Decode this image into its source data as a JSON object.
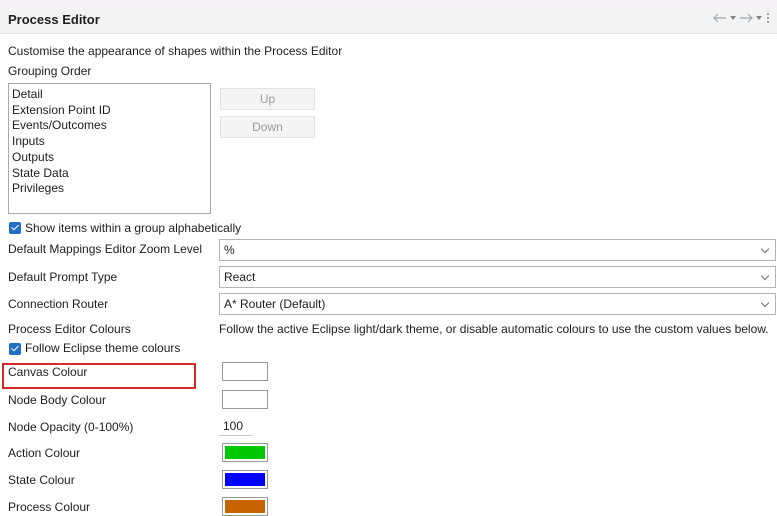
{
  "header": {
    "title": "Process Editor"
  },
  "description": "Customise the appearance of shapes within the Process Editor",
  "grouping": {
    "label": "Grouping Order",
    "items": [
      "Detail",
      "Extension Point ID",
      "Events/Outcomes",
      "Inputs",
      "Outputs",
      "State Data",
      "Privileges"
    ],
    "up_label": "Up",
    "down_label": "Down"
  },
  "show_alpha": {
    "label": "Show items within a group alphabetically",
    "checked": true
  },
  "zoom": {
    "label": "Default Mappings Editor Zoom Level",
    "value": "%"
  },
  "prompt": {
    "label": "Default Prompt Type",
    "value": "React"
  },
  "router": {
    "label": "Connection Router",
    "value": "A* Router (Default)"
  },
  "colours": {
    "label": "Process Editor Colours",
    "hint": "Follow the active Eclipse light/dark theme, or disable automatic colours to use the custom values below."
  },
  "follow_theme": {
    "label": "Follow Eclipse theme colours",
    "checked": true
  },
  "canvas_colour": {
    "label": "Canvas Colour",
    "color": "#ffffff"
  },
  "node_body_colour": {
    "label": "Node Body Colour",
    "color": "#ffffff"
  },
  "node_opacity": {
    "label": "Node Opacity (0-100%)",
    "value": "100"
  },
  "action_colour": {
    "label": "Action Colour",
    "color": "#00c800"
  },
  "state_colour": {
    "label": "State Colour",
    "color": "#0000ff"
  },
  "process_colour": {
    "label": "Process Colour",
    "color": "#c86400"
  },
  "icons": [
    "back-icon",
    "dropdown-icon",
    "forward-icon",
    "dropdown-icon",
    "view-menu-icon"
  ],
  "accent_color": "#1f6fc5",
  "highlight_color": "#d42a2a"
}
